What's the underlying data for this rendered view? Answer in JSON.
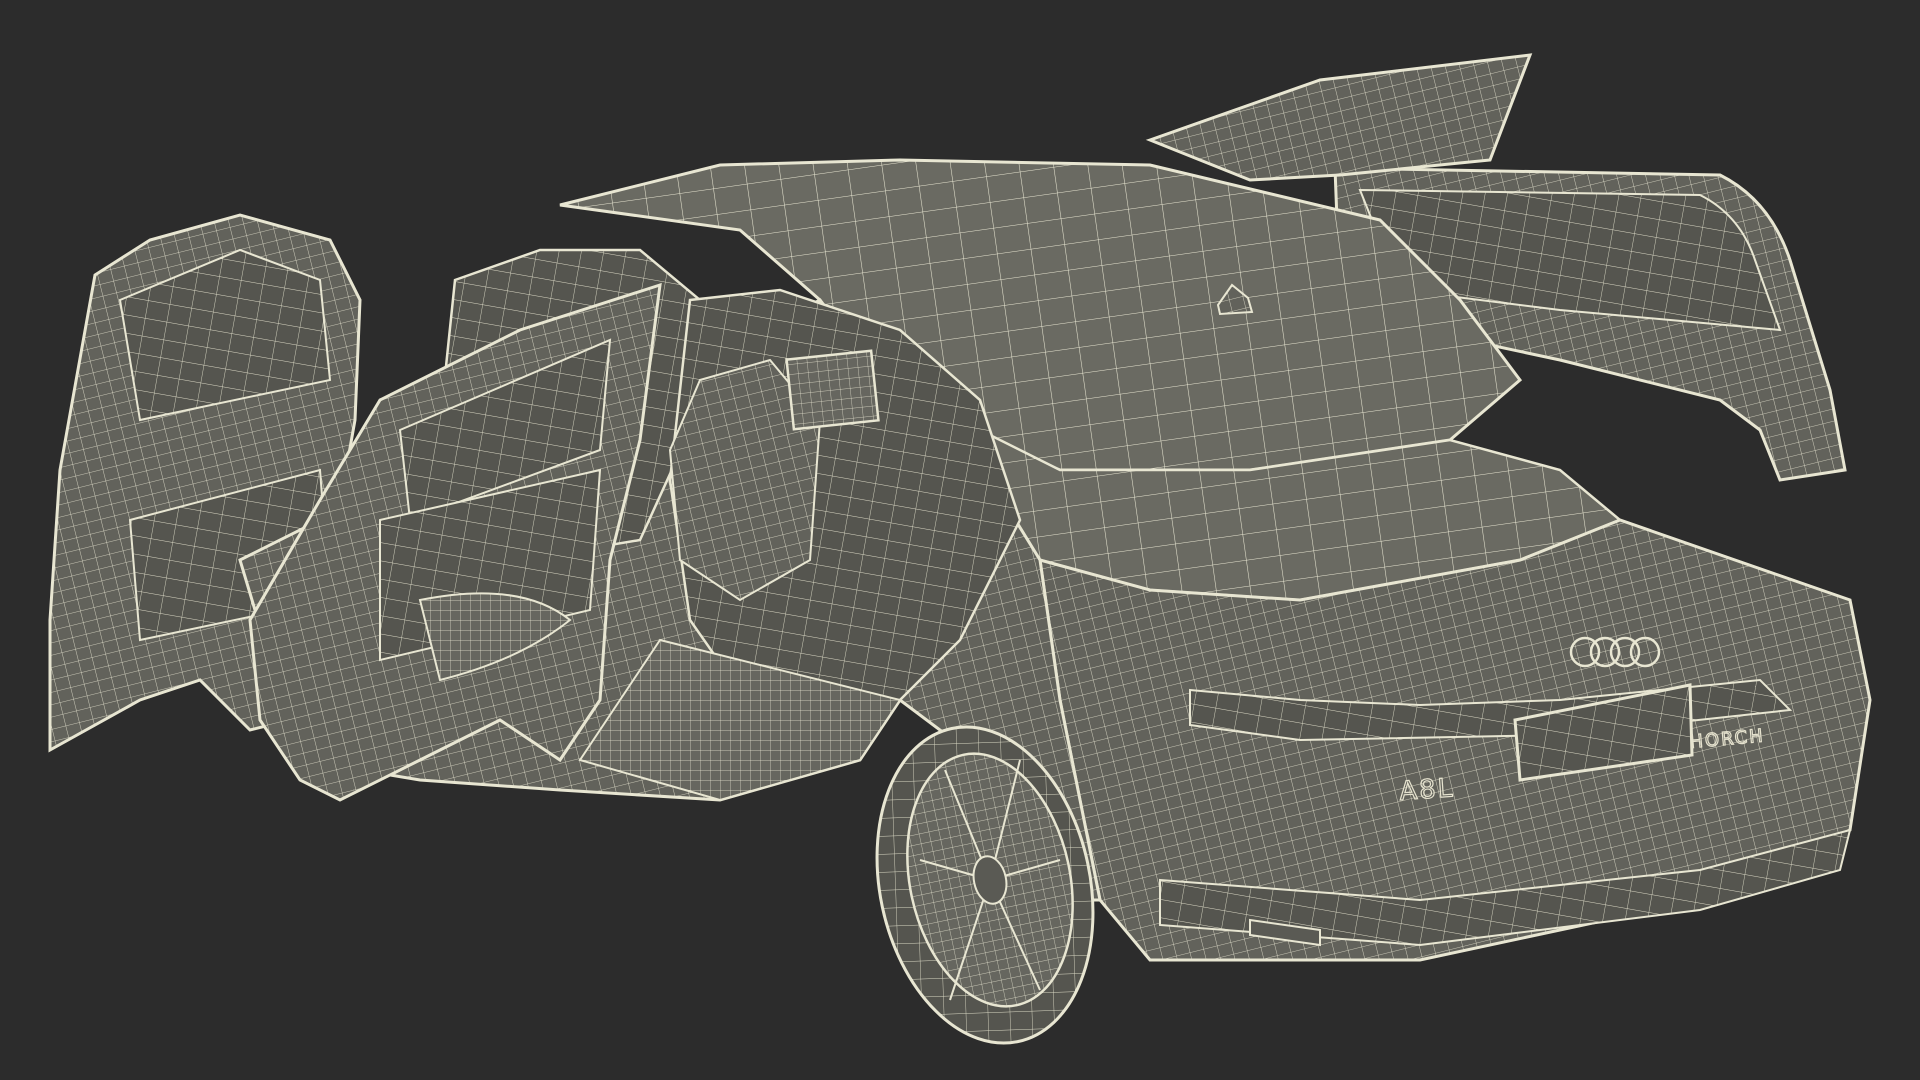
{
  "scene": {
    "background_color": "#2c2c2c",
    "surface_color": "#6a6a62",
    "surface_dark": "#4e4e48",
    "wire_color": "#e8e6d2",
    "badge_model": "A8L",
    "badge_trim": "HORCH",
    "logo": "four-rings-logo"
  }
}
